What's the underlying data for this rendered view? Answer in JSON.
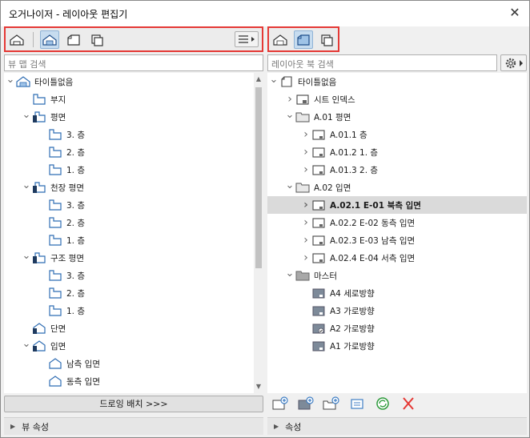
{
  "window": {
    "title": "오거나이저 - 레이아웃 편집기",
    "close": "✕"
  },
  "left": {
    "search_placeholder": "뷰 맵 검색",
    "tree": [
      {
        "label": "타이틀없음",
        "icon": "project-root-icon",
        "depth": 0,
        "chev": "down"
      },
      {
        "label": "부지",
        "icon": "site-view-icon",
        "depth": 1,
        "chev": ""
      },
      {
        "label": "평면",
        "icon": "floor-plan-folder-icon",
        "depth": 1,
        "chev": "down"
      },
      {
        "label": "3. 층",
        "icon": "story-view-icon",
        "depth": 2,
        "chev": ""
      },
      {
        "label": "2. 층",
        "icon": "story-view-icon",
        "depth": 2,
        "chev": ""
      },
      {
        "label": "1. 층",
        "icon": "story-view-icon",
        "depth": 2,
        "chev": ""
      },
      {
        "label": "천장 평면",
        "icon": "ceiling-plan-folder-icon",
        "depth": 1,
        "chev": "down"
      },
      {
        "label": "3. 층",
        "icon": "story-view-icon",
        "depth": 2,
        "chev": ""
      },
      {
        "label": "2. 층",
        "icon": "story-view-icon",
        "depth": 2,
        "chev": ""
      },
      {
        "label": "1. 층",
        "icon": "story-view-icon",
        "depth": 2,
        "chev": ""
      },
      {
        "label": "구조 평면",
        "icon": "structural-plan-folder-icon",
        "depth": 1,
        "chev": "down"
      },
      {
        "label": "3. 층",
        "icon": "story-view-icon",
        "depth": 2,
        "chev": ""
      },
      {
        "label": "2. 층",
        "icon": "story-view-icon",
        "depth": 2,
        "chev": ""
      },
      {
        "label": "1. 층",
        "icon": "story-view-icon",
        "depth": 2,
        "chev": ""
      },
      {
        "label": "단면",
        "icon": "section-icon",
        "depth": 1,
        "chev": ""
      },
      {
        "label": "입면",
        "icon": "elevation-folder-icon",
        "depth": 1,
        "chev": "down"
      },
      {
        "label": "남측 입면",
        "icon": "elevation-view-icon",
        "depth": 2,
        "chev": ""
      },
      {
        "label": "동측 입면",
        "icon": "elevation-view-icon",
        "depth": 2,
        "chev": ""
      }
    ],
    "place_button": "드로잉 배치 >>>",
    "properties": "뷰 속성"
  },
  "right": {
    "search_placeholder": "레이아웃 북 검색",
    "tree": [
      {
        "label": "타이틀없음",
        "icon": "layout-book-icon",
        "depth": 0,
        "chev": "down",
        "sel": false
      },
      {
        "label": "시트 인덱스",
        "icon": "sheet-index-icon",
        "depth": 1,
        "chev": "right",
        "sel": false
      },
      {
        "label": "A.01 평면",
        "icon": "folder-icon",
        "depth": 1,
        "chev": "down",
        "sel": false
      },
      {
        "label": "A.01.1 층",
        "icon": "layout-sheet-icon",
        "depth": 2,
        "chev": "right",
        "sel": false
      },
      {
        "label": "A.01.2 1. 층",
        "icon": "layout-sheet-icon",
        "depth": 2,
        "chev": "right",
        "sel": false
      },
      {
        "label": "A.01.3 2. 층",
        "icon": "layout-sheet-icon",
        "depth": 2,
        "chev": "right",
        "sel": false
      },
      {
        "label": "A.02 입면",
        "icon": "folder-icon",
        "depth": 1,
        "chev": "down",
        "sel": false
      },
      {
        "label": "A.02.1 E-01 북측 입면",
        "icon": "layout-sheet-icon",
        "depth": 2,
        "chev": "right",
        "sel": true
      },
      {
        "label": "A.02.2 E-02 동측 입면",
        "icon": "layout-sheet-icon",
        "depth": 2,
        "chev": "right",
        "sel": false
      },
      {
        "label": "A.02.3 E-03 남측 입면",
        "icon": "layout-sheet-icon",
        "depth": 2,
        "chev": "right",
        "sel": false
      },
      {
        "label": "A.02.4 E-04 서측 입면",
        "icon": "layout-sheet-icon",
        "depth": 2,
        "chev": "right",
        "sel": false
      },
      {
        "label": "마스터",
        "icon": "master-folder-icon",
        "depth": 1,
        "chev": "down",
        "sel": false
      },
      {
        "label": "A4 세로방향",
        "icon": "master-layout-icon",
        "depth": 2,
        "chev": "",
        "sel": false
      },
      {
        "label": "A3 가로방향",
        "icon": "master-layout-icon",
        "depth": 2,
        "chev": "",
        "sel": false
      },
      {
        "label": "A2 가로방향",
        "icon": "master-layout-default-icon",
        "depth": 2,
        "chev": "",
        "sel": false
      },
      {
        "label": "A1 가로방향",
        "icon": "master-layout-icon",
        "depth": 2,
        "chev": "",
        "sel": false
      }
    ],
    "tools": [
      {
        "name": "new-layout-icon",
        "color": "#3f7ec4"
      },
      {
        "name": "new-master-layout-icon",
        "color": "#3f7ec4"
      },
      {
        "name": "new-folder-icon",
        "color": "#3f7ec4"
      },
      {
        "name": "layout-settings-icon",
        "color": "#3f7ec4"
      },
      {
        "name": "update-icon",
        "color": "#2e9b3c"
      },
      {
        "name": "delete-icon",
        "color": "#e53935"
      }
    ],
    "properties": "속성"
  },
  "colors": {
    "accent": "#3f7ec4",
    "highlight": "#e53935",
    "selection": "#dadada"
  }
}
